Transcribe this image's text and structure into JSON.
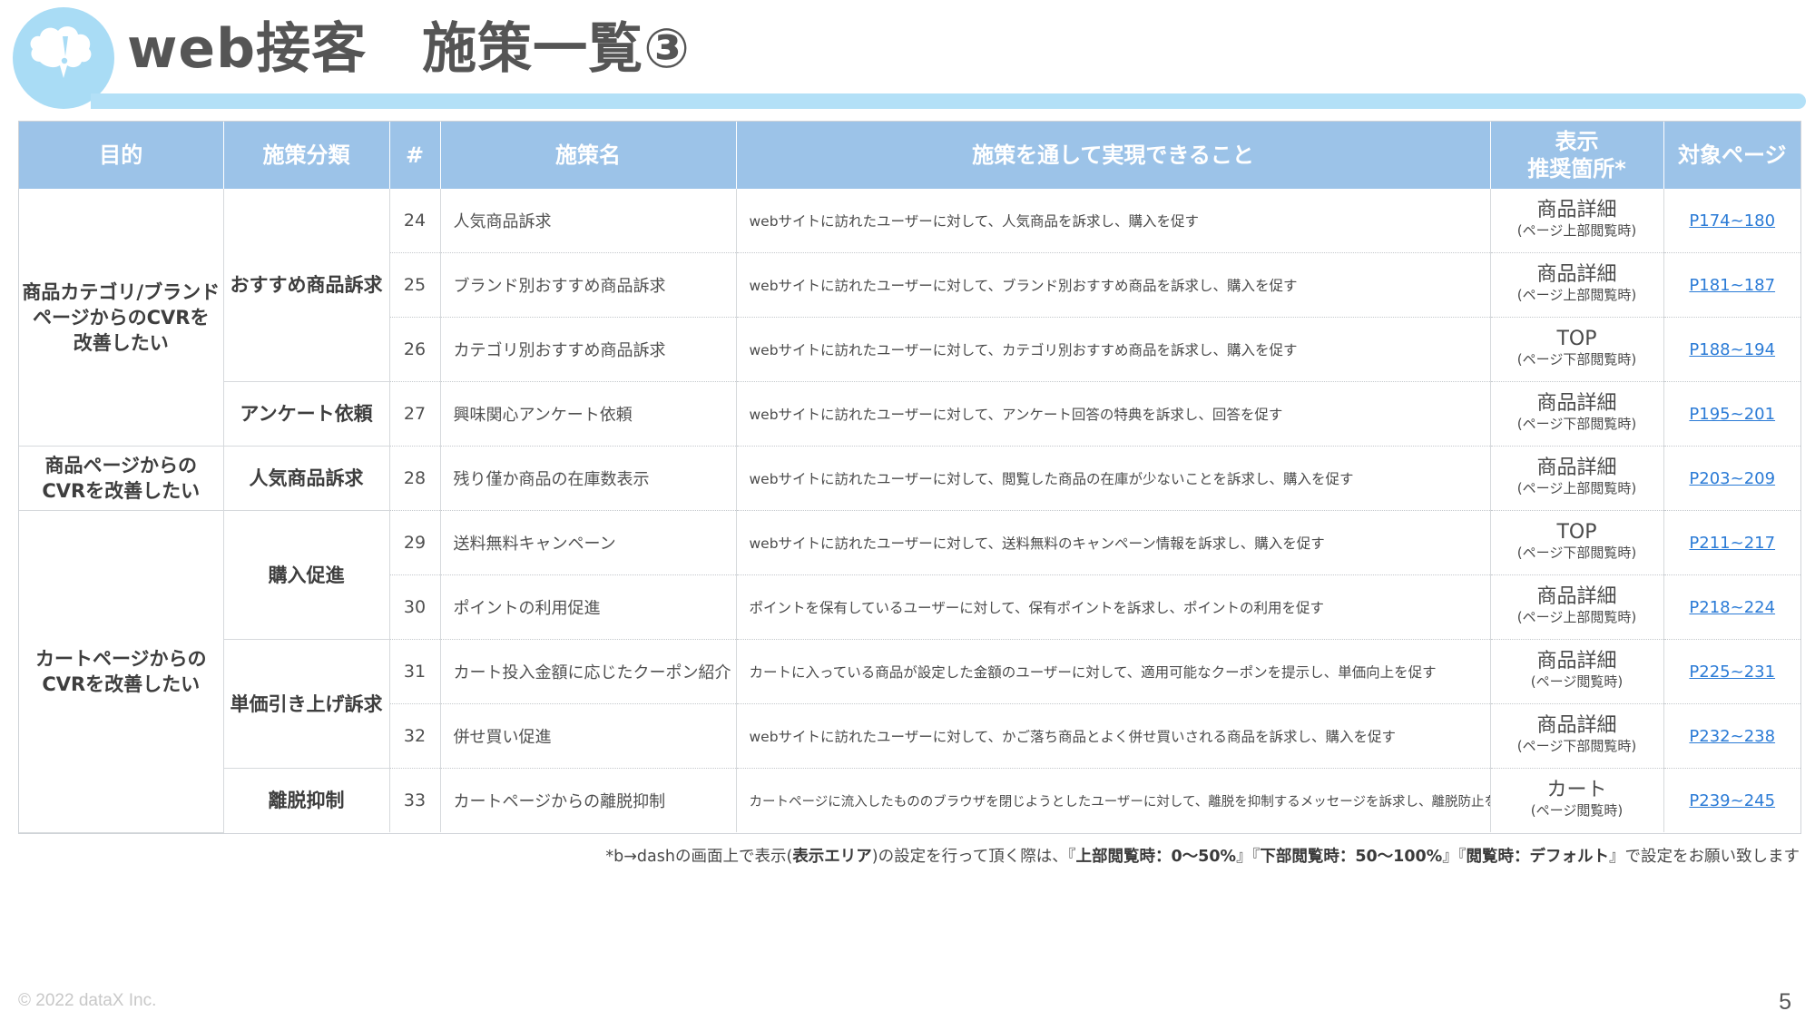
{
  "header": {
    "title": "web接客　施策一覧③",
    "logo_icon": "speech-bubble-exclamation-icon"
  },
  "table": {
    "columns": [
      "目的",
      "施策分類",
      "#",
      "施策名",
      "施策を通して実現できること",
      "表示\n推奨箇所*",
      "対象ページ"
    ],
    "purposes": [
      "商品カテゴリ/ブランド\nページからのCVRを\n改善したい",
      "商品ページからの\nCVRを改善したい",
      "カートページからの\nCVRを改善したい"
    ],
    "categories": [
      "おすすめ商品訴求",
      "アンケート依頼",
      "人気商品訴求",
      "購入促進",
      "単価引き上げ訴求",
      "離脱抑制"
    ],
    "rows": [
      {
        "num": "24",
        "name": "人気商品訴求",
        "desc": "webサイトに訪れたユーザーに対して、人気商品を訴求し、購入を促す",
        "loc_main": "商品詳細",
        "loc_sub": "(ページ上部閲覧時)",
        "page": "P174~180"
      },
      {
        "num": "25",
        "name": "ブランド別おすすめ商品訴求",
        "desc": "webサイトに訪れたユーザーに対して、ブランド別おすすめ商品を訴求し、購入を促す",
        "loc_main": "商品詳細",
        "loc_sub": "(ページ上部閲覧時)",
        "page": "P181~187"
      },
      {
        "num": "26",
        "name": "カテゴリ別おすすめ商品訴求",
        "desc": "webサイトに訪れたユーザーに対して、カテゴリ別おすすめ商品を訴求し、購入を促す",
        "loc_main": "TOP",
        "loc_sub": "(ページ下部閲覧時)",
        "page": "P188~194"
      },
      {
        "num": "27",
        "name": "興味関心アンケート依頼",
        "desc": "webサイトに訪れたユーザーに対して、アンケート回答の特典を訴求し、回答を促す",
        "loc_main": "商品詳細",
        "loc_sub": "(ページ下部閲覧時)",
        "page": "P195~201"
      },
      {
        "num": "28",
        "name": "残り僅か商品の在庫数表示",
        "desc": "webサイトに訪れたユーザーに対して、閲覧した商品の在庫が少ないことを訴求し、購入を促す",
        "loc_main": "商品詳細",
        "loc_sub": "(ページ上部閲覧時)",
        "page": "P203~209"
      },
      {
        "num": "29",
        "name": "送料無料キャンペーン",
        "desc": "webサイトに訪れたユーザーに対して、送料無料のキャンペーン情報を訴求し、購入を促す",
        "loc_main": "TOP",
        "loc_sub": "(ページ下部閲覧時)",
        "page": "P211~217"
      },
      {
        "num": "30",
        "name": "ポイントの利用促進",
        "desc": "ポイントを保有しているユーザーに対して、保有ポイントを訴求し、ポイントの利用を促す",
        "loc_main": "商品詳細",
        "loc_sub": "(ページ上部閲覧時)",
        "page": "P218~224"
      },
      {
        "num": "31",
        "name": "カート投入金額に応じたクーポン紹介",
        "desc": "カートに入っている商品が設定した金額のユーザーに対して、適用可能なクーポンを提示し、単価向上を促す",
        "loc_main": "商品詳細",
        "loc_sub": "(ページ閲覧時)",
        "page": "P225~231"
      },
      {
        "num": "32",
        "name": "併せ買い促進",
        "desc": "webサイトに訪れたユーザーに対して、かご落ち商品とよく併せ買いされる商品を訴求し、購入を促す",
        "loc_main": "商品詳細",
        "loc_sub": "(ページ下部閲覧時)",
        "page": "P232~238"
      },
      {
        "num": "33",
        "name": "カートページからの離脱抑制",
        "desc": "カートページに流入したもののブラウザを閉じようとしたユーザーに対して、離脱を抑制するメッセージを訴求し、離脱防止を促す",
        "loc_main": "カート",
        "loc_sub": "(ページ閲覧時)",
        "page": "P239~245"
      }
    ]
  },
  "footnote": {
    "p1": "*b→dashの画面上で表示(",
    "b1": "表示エリア",
    "p2": ")の設定を行って頂く際は、『",
    "b2": "上部閲覧時：0〜50%",
    "p3": "』『",
    "b3": "下部閲覧時：50〜100%",
    "p4": "』『",
    "b4": "閲覧時：デフォルト",
    "p5": "』で設定をお願い致します"
  },
  "footer": {
    "copyright": "© 2022 dataX Inc.",
    "page_number": "5"
  }
}
